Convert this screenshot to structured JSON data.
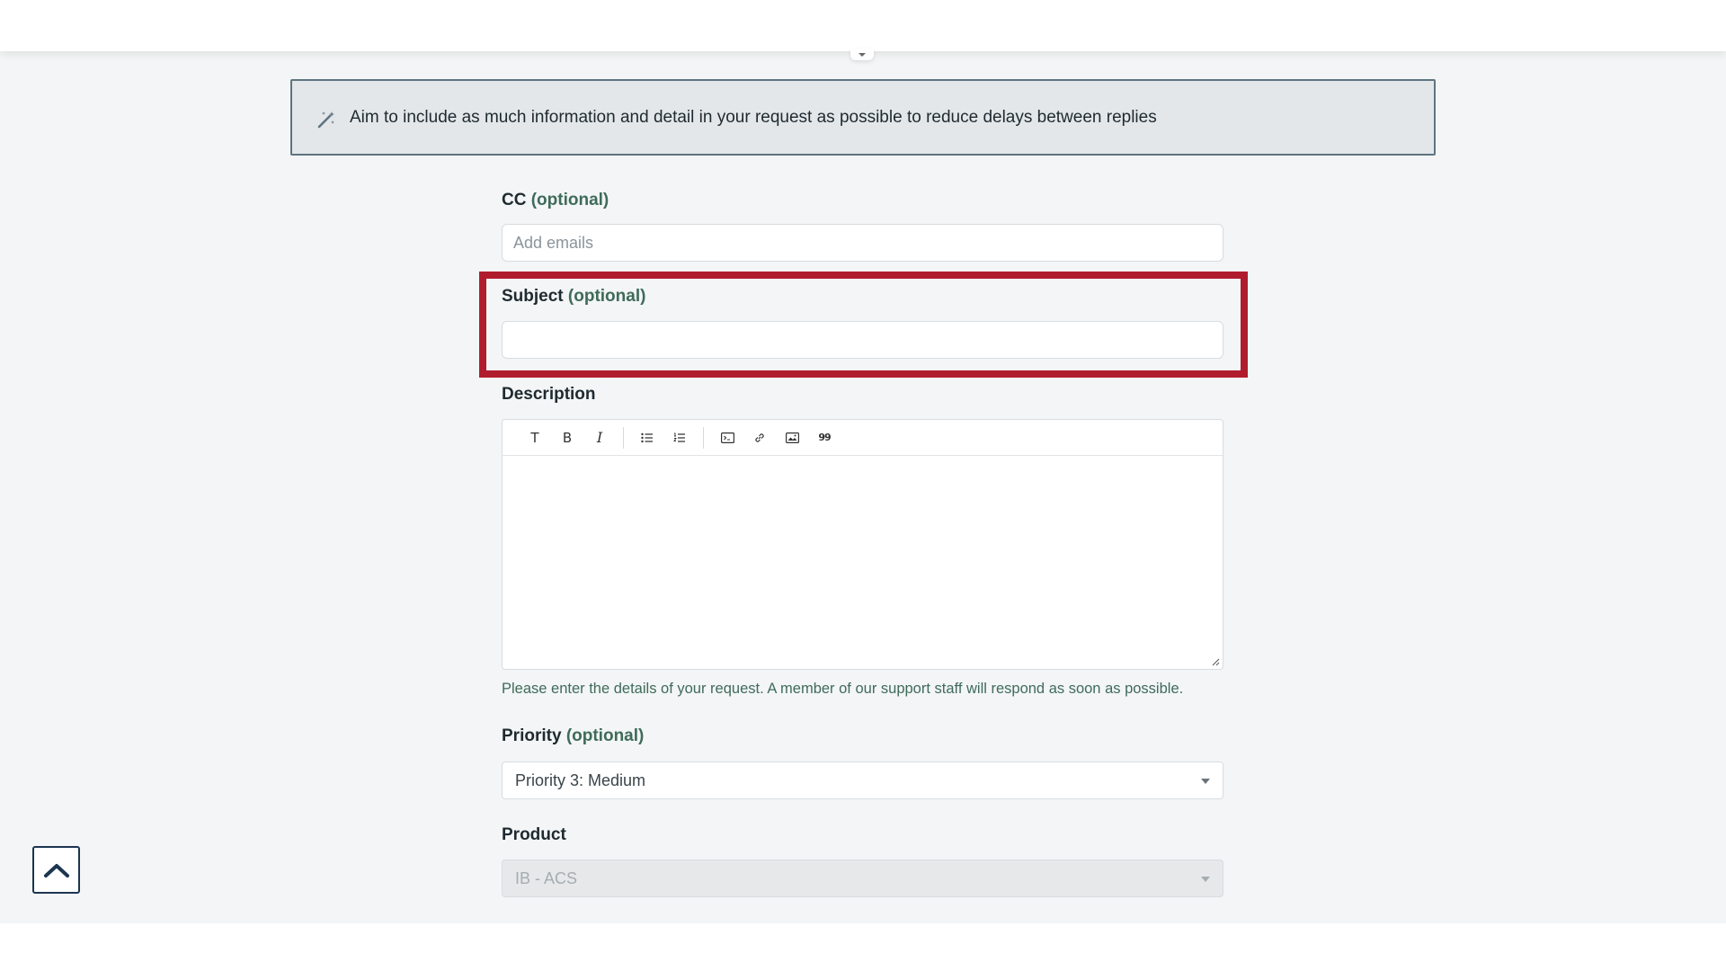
{
  "notice": {
    "text": "Aim to include as much information and detail in your request as possible to reduce delays between replies",
    "icon": "magic-wand-icon"
  },
  "cc": {
    "label": "CC",
    "optional": "(optional)",
    "placeholder": "Add emails"
  },
  "subject": {
    "label": "Subject",
    "optional": "(optional)",
    "value": ""
  },
  "description": {
    "label": "Description",
    "toolbar": [
      {
        "name": "text-style-button",
        "glyph": "T"
      },
      {
        "name": "bold-button",
        "glyph": "B"
      },
      {
        "name": "italic-button",
        "glyph": "I"
      },
      {
        "name": "bullet-list-button",
        "glyph": ""
      },
      {
        "name": "numbered-list-button",
        "glyph": ""
      },
      {
        "name": "code-block-button",
        "glyph": ""
      },
      {
        "name": "link-button",
        "glyph": ""
      },
      {
        "name": "image-button",
        "glyph": ""
      },
      {
        "name": "quote-button",
        "glyph": "99"
      }
    ],
    "helper": "Please enter the details of your request. A member of our support staff will respond as soon as possible."
  },
  "priority": {
    "label": "Priority",
    "optional": "(optional)",
    "selected": "Priority 3: Medium"
  },
  "product": {
    "label": "Product",
    "selected": "IB - ACS"
  },
  "colors": {
    "highlight": "#b01c2e",
    "optional_text": "#3f6b5a",
    "notice_border": "#5e7481"
  }
}
